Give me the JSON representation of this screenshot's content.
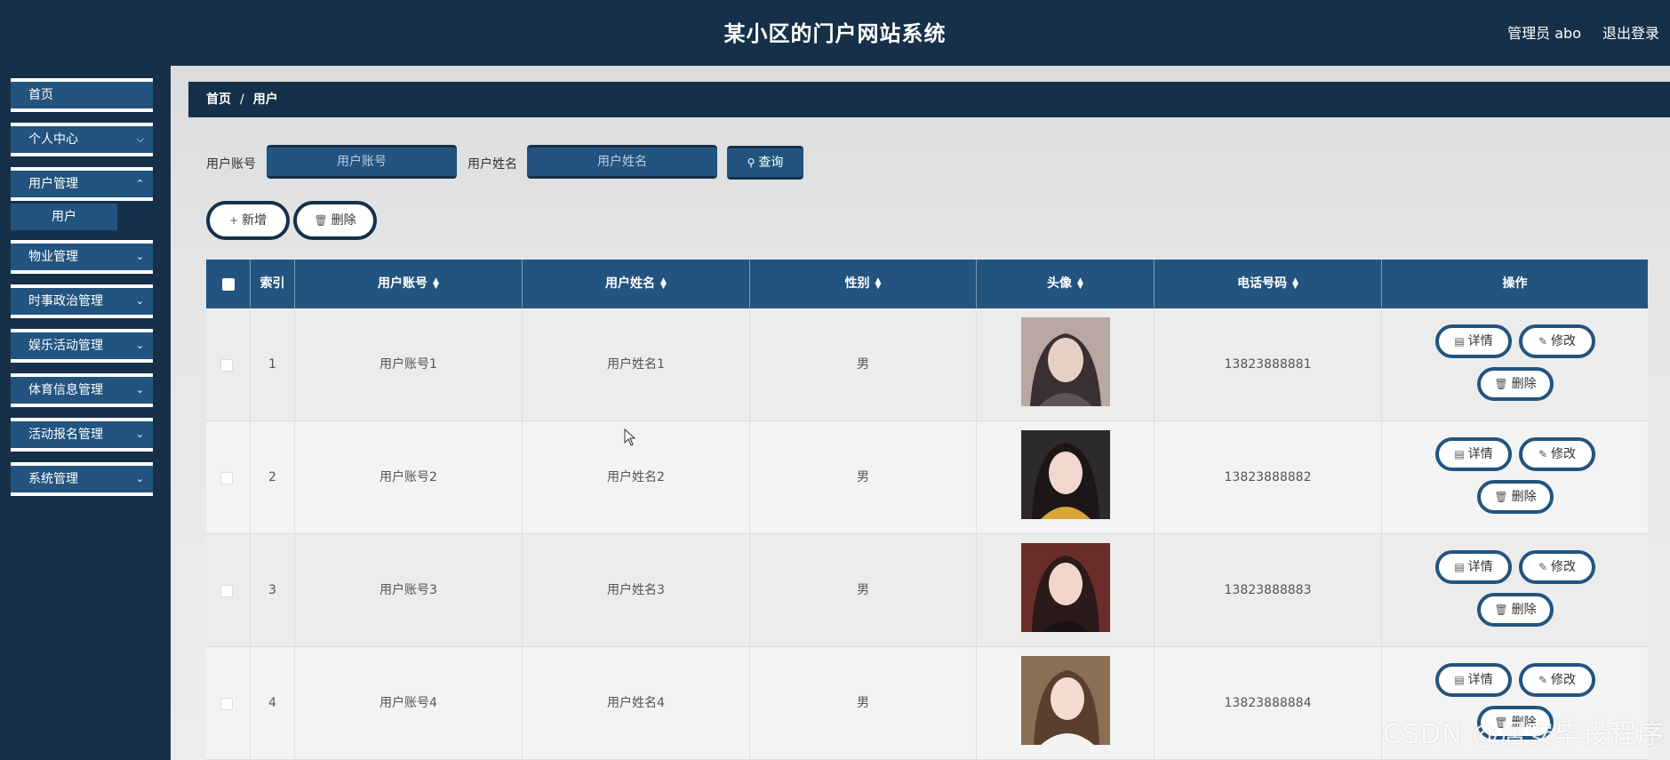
{
  "header": {
    "title": "某小区的门户网站系统",
    "admin": "管理员 abo",
    "logout": "退出登录"
  },
  "sidebar": {
    "items": [
      {
        "label": "首页"
      },
      {
        "label": "个人中心"
      },
      {
        "label": "用户管理",
        "expanded": true,
        "children": [
          {
            "label": "用户"
          }
        ]
      },
      {
        "label": "物业管理"
      },
      {
        "label": "时事政治管理"
      },
      {
        "label": "娱乐活动管理"
      },
      {
        "label": "体育信息管理"
      },
      {
        "label": "活动报名管理"
      },
      {
        "label": "系统管理"
      }
    ]
  },
  "breadcrumb": {
    "home": "首页",
    "sep": "/",
    "current": "用户"
  },
  "search": {
    "account_label": "用户账号",
    "account_placeholder": "用户账号",
    "name_label": "用户姓名",
    "name_placeholder": "用户姓名",
    "query_btn": "查询"
  },
  "actions": {
    "add": "新增",
    "delete": "删除"
  },
  "table": {
    "columns": [
      "索引",
      "用户账号",
      "用户姓名",
      "性别",
      "头像",
      "电话号码",
      "操作"
    ],
    "rows": [
      {
        "index": "1",
        "account": "用户账号1",
        "name": "用户姓名1",
        "gender": "男",
        "phone": "13823888881"
      },
      {
        "index": "2",
        "account": "用户账号2",
        "name": "用户姓名2",
        "gender": "男",
        "phone": "13823888882"
      },
      {
        "index": "3",
        "account": "用户账号3",
        "name": "用户姓名3",
        "gender": "男",
        "phone": "13823888883"
      },
      {
        "index": "4",
        "account": "用户账号4",
        "name": "用户姓名4",
        "gender": "男",
        "phone": "13823888884"
      }
    ],
    "row_actions": {
      "detail": "详情",
      "edit": "修改",
      "delete": "删除"
    }
  },
  "watermark": "CSDN @居安毕设程序",
  "colors": {
    "dark": "#163049",
    "primary": "#22547f"
  }
}
